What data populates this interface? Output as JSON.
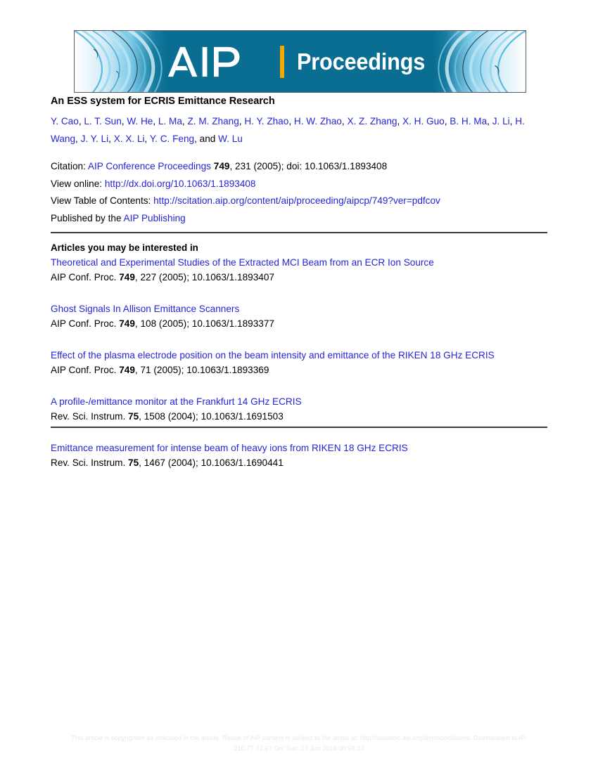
{
  "banner": {
    "logo_text": "AIP",
    "divider_color": "#f2a900",
    "product_word": "Proceedings",
    "background_color": "#0a6d92",
    "swirl_color": "#6fc9e8"
  },
  "article": {
    "title": "An ESS system for ECRIS Emittance Research",
    "authors": [
      {
        "name": "Y. Cao",
        "sep": ", "
      },
      {
        "name": "L. T. Sun",
        "sep": ", "
      },
      {
        "name": "W. He",
        "sep": ", "
      },
      {
        "name": "L. Ma",
        "sep": ", "
      },
      {
        "name": "Z. M. Zhang",
        "sep": ", "
      },
      {
        "name": "H. Y. Zhao",
        "sep": ", "
      },
      {
        "name": "H. W. Zhao",
        "sep": ", "
      },
      {
        "name": "X. Z. Zhang",
        "sep": ", "
      },
      {
        "name": "X. H. Guo",
        "sep": ", "
      },
      {
        "name": "B. H. Ma",
        "sep": ", "
      },
      {
        "name": "J. Li",
        "sep": ", "
      },
      {
        "name": "H. Wang",
        "sep": ", "
      },
      {
        "name": "J. Y. Li",
        "sep": ", "
      },
      {
        "name": "X. X. Li",
        "sep": ", "
      },
      {
        "name": "Y. C. Feng",
        "sep": ", and "
      },
      {
        "name": "W. Lu",
        "sep": ""
      }
    ]
  },
  "citation": {
    "label": "Citation: ",
    "journal": "AIP Conference Proceedings",
    "volume": "749",
    "rest": ", 231 (2005); doi: 10.1063/1.1893408",
    "view_online_label": "View online: ",
    "view_online_url": "http://dx.doi.org/10.1063/1.1893408",
    "toc_label": "View Table of Contents: ",
    "toc_url": "http://scitation.aip.org/content/aip/proceeding/aipcp/749?ver=pdfcov",
    "publisher_label": "Published by the ",
    "publisher_name": "AIP Publishing"
  },
  "related": {
    "heading": "Articles you may be interested in",
    "items": [
      {
        "title": "Theoretical and Experimental Studies of the Extracted MCI Beam from an ECR Ion Source",
        "source": "AIP Conf. Proc. ",
        "volume": "749",
        "ref_rest": ", 227 (2005); 10.1063/1.1893407"
      },
      {
        "title": "Ghost Signals In Allison Emittance Scanners",
        "source": "AIP Conf. Proc. ",
        "volume": "749",
        "ref_rest": ", 108 (2005); 10.1063/1.1893377"
      },
      {
        "title": "Effect of the plasma electrode position on the beam intensity and emittance of the RIKEN 18 GHz ECRIS",
        "source": "AIP Conf. Proc. ",
        "volume": "749",
        "ref_rest": ", 71 (2005); 10.1063/1.1893369"
      },
      {
        "title": "A profile-/emittance monitor at the Frankfurt 14 GHz ECRIS",
        "source": "Rev. Sci. Instrum. ",
        "volume": "75",
        "ref_rest": ", 1508 (2004); 10.1063/1.1691503"
      },
      {
        "title": "Emittance measurement for intense beam of heavy ions from RIKEN 18 GHz ECRIS",
        "source": "Rev. Sci. Instrum. ",
        "volume": "75",
        "ref_rest": ", 1467 (2004); 10.1063/1.1690441"
      }
    ]
  },
  "footer": {
    "line1": "This article is copyrighted as indicated in the article. Reuse of AIP content is subject to the terms at: http://scitation.aip.org/termsconditions. Downloaded to  IP:",
    "line2": "210.77.72.67 On: Tue, 17 Jun 2014 00:59:23"
  },
  "colors": {
    "link": "#2525d6",
    "rule": "#3a3a3a",
    "footer_text": "#e9e9e9"
  }
}
